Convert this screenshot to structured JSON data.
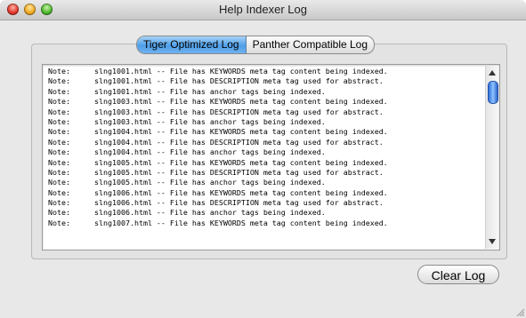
{
  "window": {
    "title": "Help Indexer Log"
  },
  "tabs": [
    {
      "label": "Tiger Optimized Log",
      "selected": true
    },
    {
      "label": "Panther Compatible Log",
      "selected": false
    }
  ],
  "log": {
    "lines": [
      {
        "level": "Note:",
        "text": "slng1001.html -- File has KEYWORDS meta tag content being indexed."
      },
      {
        "level": "Note:",
        "text": "slng1001.html -- File has DESCRIPTION meta tag used for abstract."
      },
      {
        "level": "Note:",
        "text": "slng1001.html -- File has anchor tags being indexed."
      },
      {
        "level": "Note:",
        "text": "slng1003.html -- File has KEYWORDS meta tag content being indexed."
      },
      {
        "level": "Note:",
        "text": "slng1003.html -- File has DESCRIPTION meta tag used for abstract."
      },
      {
        "level": "Note:",
        "text": "slng1003.html -- File has anchor tags being indexed."
      },
      {
        "level": "Note:",
        "text": "slng1004.html -- File has KEYWORDS meta tag content being indexed."
      },
      {
        "level": "Note:",
        "text": "slng1004.html -- File has DESCRIPTION meta tag used for abstract."
      },
      {
        "level": "Note:",
        "text": "slng1004.html -- File has anchor tags being indexed."
      },
      {
        "level": "Note:",
        "text": "slng1005.html -- File has KEYWORDS meta tag content being indexed."
      },
      {
        "level": "Note:",
        "text": "slng1005.html -- File has DESCRIPTION meta tag used for abstract."
      },
      {
        "level": "Note:",
        "text": "slng1005.html -- File has anchor tags being indexed."
      },
      {
        "level": "Note:",
        "text": "slng1006.html -- File has KEYWORDS meta tag content being indexed."
      },
      {
        "level": "Note:",
        "text": "slng1006.html -- File has DESCRIPTION meta tag used for abstract."
      },
      {
        "level": "Note:",
        "text": "slng1006.html -- File has anchor tags being indexed."
      },
      {
        "level": "Note:",
        "text": "slng1007.html -- File has KEYWORDS meta tag content being indexed."
      }
    ]
  },
  "buttons": {
    "clear_log": "Clear Log"
  },
  "icons": {
    "close": "close-icon",
    "minimize": "minimize-icon",
    "zoom": "zoom-icon",
    "resize": "resize-grip-icon"
  },
  "colors": {
    "selected_tab": "#4f9ee8",
    "close": "#e0362a",
    "minimize": "#f0a820",
    "zoom": "#4cb52b"
  }
}
